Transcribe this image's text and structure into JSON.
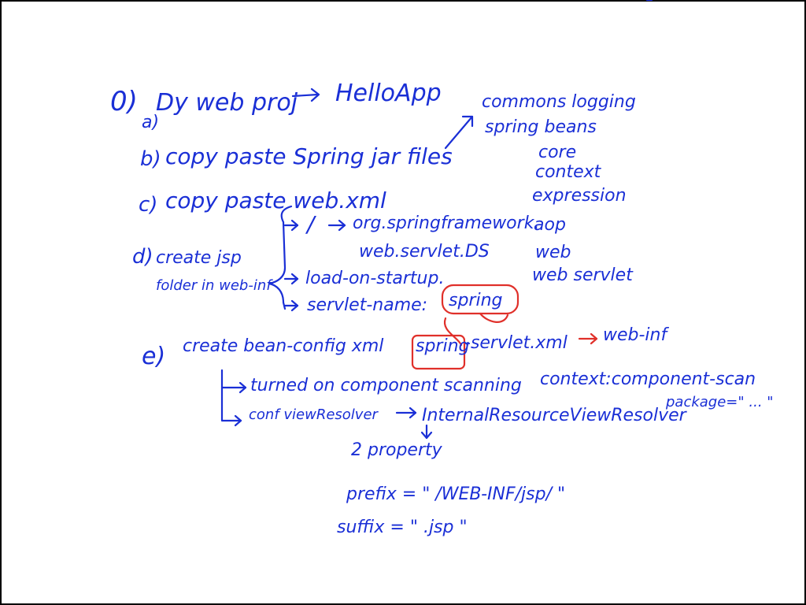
{
  "notes": {
    "step0_label": "0)",
    "step_a": {
      "label": "a)",
      "text": "Dy web proj",
      "target": "HelloApp"
    },
    "step_b": {
      "label": "b)",
      "text": "copy paste Spring jar files"
    },
    "jars": [
      "commons logging",
      "spring beans",
      "core",
      "context",
      "expression",
      "aop",
      "web",
      "web servlet"
    ],
    "step_c": {
      "label": "c)",
      "text": "copy paste web.xml",
      "mapping": "/",
      "servlet_class_1": "org.springframework.",
      "servlet_class_2": "web.servlet.DS",
      "load_on_startup": "load-on-startup.",
      "servlet_name": "servlet-name:",
      "servlet_name_value": "spring"
    },
    "step_d": {
      "label": "d)",
      "line1": "create jsp",
      "line2": "folder in web-inf"
    },
    "step_e": {
      "label": "e)",
      "text_prefix": "create bean-config xml",
      "file_highlight": "spring",
      "file_suffix": "-servlet.xml",
      "target": "web-inf",
      "component_scan_text": "turned on component scanning",
      "component_scan_tag": "context:component-scan",
      "package_attr": "package=\" ... \"",
      "view_resolver_text": "conf viewResolver",
      "view_resolver_class": "InternalResourceViewResolver",
      "property_count": "2 property",
      "prefix_line": "prefix = \" /WEB-INF/jsp/ \"",
      "suffix_line": "suffix = \" .jsp \""
    }
  },
  "colors": {
    "background": "#ffffff",
    "ink_blue": "#1a2fd6",
    "ink_red": "#e0302a",
    "frame": "#000000"
  }
}
